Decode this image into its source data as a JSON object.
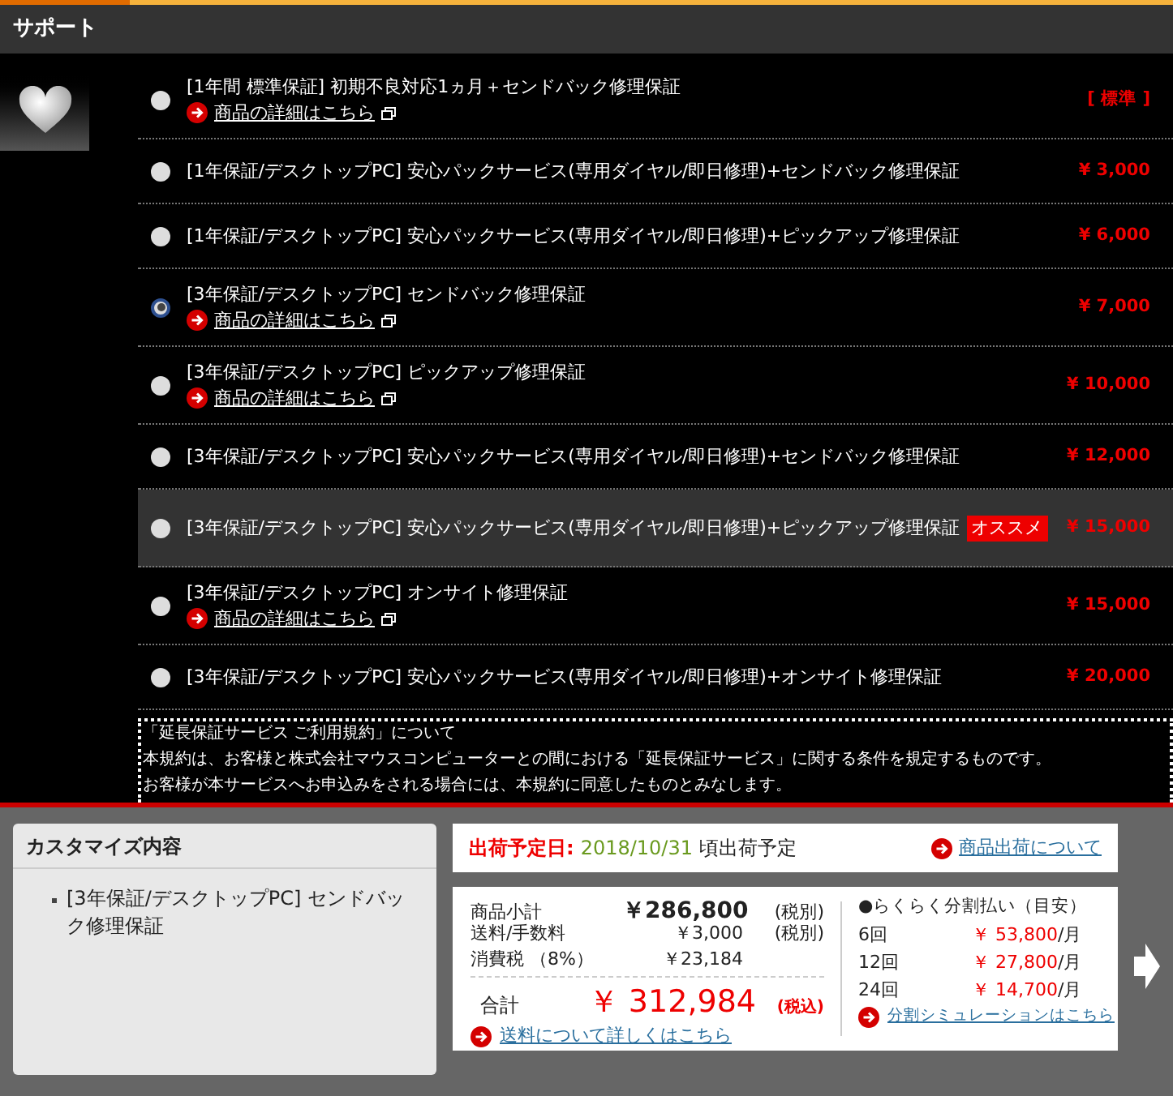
{
  "header": {
    "title": "サポート"
  },
  "options": [
    {
      "label": "[1年間 標準保証] 初期不良対応1ヵ月＋センドバック修理保証",
      "link": "商品の詳細はこちら",
      "price": "[ 標準 ]",
      "selected": false,
      "highlighted": false
    },
    {
      "label": "[1年保証/デスクトップPC] 安心パックサービス(専用ダイヤル/即日修理)+センドバック修理保証",
      "price": "¥ 3,000",
      "selected": false,
      "highlighted": false
    },
    {
      "label": "[1年保証/デスクトップPC] 安心パックサービス(専用ダイヤル/即日修理)+ピックアップ修理保証",
      "price": "¥ 6,000",
      "selected": false,
      "highlighted": false
    },
    {
      "label": "[3年保証/デスクトップPC] センドバック修理保証",
      "link": "商品の詳細はこちら",
      "price": "¥ 7,000",
      "selected": true,
      "highlighted": false
    },
    {
      "label": "[3年保証/デスクトップPC] ピックアップ修理保証",
      "link": "商品の詳細はこちら",
      "price": "¥ 10,000",
      "selected": false,
      "highlighted": false
    },
    {
      "label": "[3年保証/デスクトップPC] 安心パックサービス(専用ダイヤル/即日修理)+センドバック修理保証",
      "price": "¥ 12,000",
      "selected": false,
      "highlighted": false
    },
    {
      "label": "[3年保証/デスクトップPC] 安心パックサービス(専用ダイヤル/即日修理)+ピックアップ修理保証",
      "badge": "オススメ",
      "price": "¥ 15,000",
      "selected": false,
      "highlighted": true
    },
    {
      "label": "[3年保証/デスクトップPC] オンサイト修理保証",
      "link": "商品の詳細はこちら",
      "price": "¥ 15,000",
      "selected": false,
      "highlighted": false
    },
    {
      "label": "[3年保証/デスクトップPC] 安心パックサービス(専用ダイヤル/即日修理)+オンサイト修理保証",
      "price": "¥ 20,000",
      "selected": false,
      "highlighted": false
    }
  ],
  "terms": [
    "「延長保証サービス ご利用規約」について",
    "本規約は、お客様と株式会社マウスコンピューターとの間における「延長保証サービス」に関する条件を規定するものです。",
    "お客様が本サービスへお申込みをされる場合には、本規約に同意したものとみなします。"
  ],
  "customize": {
    "title": "カスタマイズ内容",
    "items": [
      "[3年保証/デスクトップPC] センドバック修理保証"
    ]
  },
  "shipping": {
    "label": "出荷予定日:",
    "date": "2018/10/31",
    "suffix": "頃出荷予定",
    "link": "商品出荷について"
  },
  "totals": {
    "rows": [
      {
        "label": "商品小計",
        "value": "￥286,800",
        "note": "(税別)",
        "kind": "bold"
      },
      {
        "label": "送料/手数料",
        "value": "￥3,000",
        "note": "(税別)",
        "kind": "plain"
      },
      {
        "label": "消費税 （8%）",
        "value": "￥23,184",
        "kind": "plain"
      }
    ],
    "total": {
      "label": "合計",
      "value": "￥ 312,984",
      "note": "(税込)"
    },
    "link": "送料について詳しくはこちら"
  },
  "installments": {
    "title": "●らくらく分割払い（目安）",
    "rows": [
      {
        "count": "6回",
        "amount": "￥ 53,800",
        "unit": "/月"
      },
      {
        "count": "12回",
        "amount": "￥ 27,800",
        "unit": "/月"
      },
      {
        "count": "24回",
        "amount": "￥ 14,700",
        "unit": "/月"
      }
    ],
    "link": "分割シミュレーションはこちら"
  }
}
